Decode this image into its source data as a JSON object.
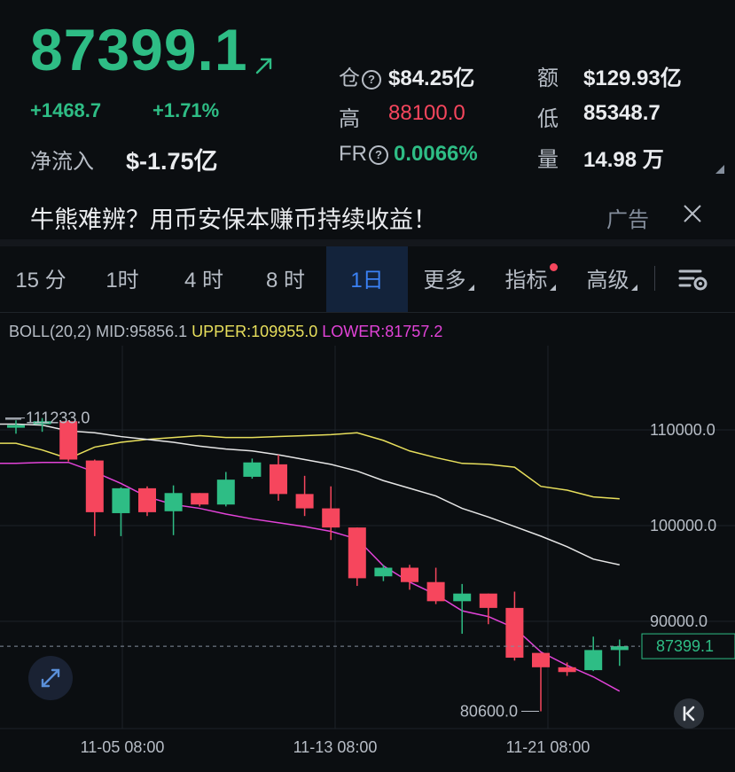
{
  "ticker": {
    "price": "87399.1",
    "change": "+1468.7",
    "change_pct": "+1.71%",
    "net_flow_label": "净流入",
    "net_flow_value": "$-1.75亿",
    "open_interest_label": "仓",
    "open_interest_value": "$84.25亿",
    "turnover_label": "额",
    "turnover_value": "$129.93亿",
    "high_label": "高",
    "high_value": "88100.0",
    "low_label": "低",
    "low_value": "85348.7",
    "fr_label": "FR",
    "fr_value": "0.0066%",
    "volume_label": "量",
    "volume_value": "14.98 万",
    "help_glyph": "?"
  },
  "ad": {
    "text": "牛熊难辨？用币安保本赚币持续收益！",
    "tag": "广告"
  },
  "tabs": [
    {
      "label": "15 分"
    },
    {
      "label": "1时"
    },
    {
      "label": "4 时"
    },
    {
      "label": "8 时"
    },
    {
      "label": "1日",
      "active": true
    },
    {
      "label": "更多"
    },
    {
      "label": "指标"
    },
    {
      "label": "高级"
    }
  ],
  "indicator": {
    "name": "BOLL(20,2)",
    "mid": "MID:95856.1",
    "upper": "UPPER:109955.0",
    "lower": "LOWER:81757.2"
  },
  "colors": {
    "up": "#2ebd85",
    "down": "#f6465d",
    "upper_band": "#e8df5c",
    "mid_band": "#e6e6e6",
    "lower_band": "#e243d8",
    "active_tab": "#3b82f6"
  },
  "chart_data": {
    "type": "candlestick",
    "x_tick_labels": [
      "11-05 08:00",
      "11-13 08:00",
      "11-21 08:00"
    ],
    "y_tick_labels": [
      "110000.0",
      "100000.0",
      "90000.0"
    ],
    "ylim": [
      80600,
      111233
    ],
    "max_label": "111233.0",
    "min_label": "80600.0",
    "last_price_label": "87399.1",
    "candles": [
      {
        "o": 110300,
        "h": 111000,
        "l": 109600,
        "c": 110500
      },
      {
        "o": 110600,
        "h": 111233,
        "l": 109800,
        "c": 110900
      },
      {
        "o": 110900,
        "h": 111000,
        "l": 106700,
        "c": 106900
      },
      {
        "o": 106800,
        "h": 106900,
        "l": 98900,
        "c": 101400
      },
      {
        "o": 101300,
        "h": 104000,
        "l": 98900,
        "c": 103900
      },
      {
        "o": 103900,
        "h": 104100,
        "l": 101000,
        "c": 101400
      },
      {
        "o": 101500,
        "h": 104200,
        "l": 99000,
        "c": 103400
      },
      {
        "o": 103400,
        "h": 103400,
        "l": 102000,
        "c": 102200
      },
      {
        "o": 102200,
        "h": 105600,
        "l": 102000,
        "c": 104800
      },
      {
        "o": 105100,
        "h": 107000,
        "l": 104900,
        "c": 106600
      },
      {
        "o": 106400,
        "h": 107400,
        "l": 102600,
        "c": 103300
      },
      {
        "o": 103300,
        "h": 105200,
        "l": 101000,
        "c": 101800
      },
      {
        "o": 101800,
        "h": 104100,
        "l": 98500,
        "c": 99800
      },
      {
        "o": 99800,
        "h": 99800,
        "l": 93700,
        "c": 94500
      },
      {
        "o": 94700,
        "h": 95900,
        "l": 94200,
        "c": 95600
      },
      {
        "o": 95600,
        "h": 95900,
        "l": 93300,
        "c": 94100
      },
      {
        "o": 94100,
        "h": 95600,
        "l": 91800,
        "c": 92100
      },
      {
        "o": 92100,
        "h": 93900,
        "l": 88700,
        "c": 92900
      },
      {
        "o": 92900,
        "h": 92900,
        "l": 89700,
        "c": 91400
      },
      {
        "o": 91400,
        "h": 93100,
        "l": 85900,
        "c": 86200
      },
      {
        "o": 86700,
        "h": 86700,
        "l": 80600,
        "c": 85200
      },
      {
        "o": 85200,
        "h": 85700,
        "l": 84300,
        "c": 84700
      },
      {
        "o": 84900,
        "h": 88400,
        "l": 84800,
        "c": 87000
      },
      {
        "o": 87000,
        "h": 88100,
        "l": 85348.7,
        "c": 87399.1
      }
    ],
    "upper": [
      108600,
      107900,
      107000,
      108200,
      108700,
      109000,
      109200,
      109400,
      109200,
      109200,
      109300,
      109400,
      109500,
      109700,
      108900,
      107800,
      107100,
      106500,
      106400,
      106100,
      104100,
      103700,
      103000,
      102800
    ],
    "mid": [
      110600,
      110500,
      109900,
      109700,
      109300,
      109000,
      108700,
      108300,
      108000,
      107800,
      107400,
      106900,
      106400,
      105700,
      104700,
      103900,
      103100,
      101800,
      100900,
      99900,
      98900,
      97800,
      96500,
      95900
    ],
    "lower": [
      106500,
      106600,
      106600,
      105600,
      104400,
      103000,
      102200,
      101800,
      101200,
      100700,
      100300,
      99900,
      99400,
      98600,
      95800,
      94100,
      92800,
      91100,
      90500,
      89300,
      86800,
      85400,
      84200,
      82700
    ]
  }
}
